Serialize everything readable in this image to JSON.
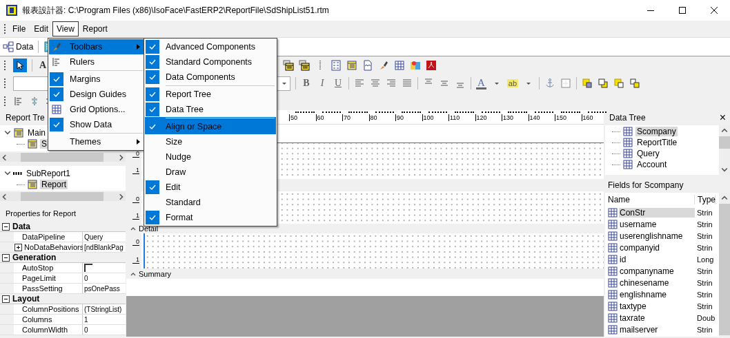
{
  "window": {
    "title": "報表設計器: C:\\Program Files (x86)\\IsoFace\\FastERP2\\ReportFile\\SdShipList51.rtm"
  },
  "menu_bar": [
    {
      "label": "File",
      "selected": false
    },
    {
      "label": "Edit",
      "selected": false
    },
    {
      "label": "View",
      "selected": true
    },
    {
      "label": "Report",
      "selected": false
    }
  ],
  "tab_bar": {
    "data_button": "Data"
  },
  "component_toolbar": {
    "label_tool": "A"
  },
  "format_toolbar": {
    "bold": "B",
    "italic": "I",
    "underline": "U",
    "font_color": "A",
    "highlight": "ab"
  },
  "view_menu": [
    {
      "label": "Toolbars",
      "kind": "tools",
      "checked": false,
      "selected": true,
      "submenu": true,
      "separator_before": false
    },
    {
      "label": "Rulers",
      "kind": "ruler",
      "checked": false,
      "selected": false,
      "submenu": false,
      "separator_before": false
    },
    {
      "label": "Margins",
      "checked": true,
      "selected": false,
      "submenu": false,
      "separator_before": true
    },
    {
      "label": "Design Guides",
      "checked": true,
      "selected": false,
      "submenu": false,
      "separator_before": false
    },
    {
      "label": "Grid Options...",
      "kind": "grid",
      "checked": false,
      "selected": false,
      "submenu": false,
      "separator_before": false
    },
    {
      "label": "Show Data",
      "checked": true,
      "selected": false,
      "submenu": false,
      "separator_before": false
    },
    {
      "label": "Themes",
      "checked": false,
      "selected": false,
      "submenu": true,
      "separator_before": true
    }
  ],
  "toolbars_submenu": [
    {
      "label": "Advanced Components",
      "checked": true,
      "selected": false,
      "separator_before": false
    },
    {
      "label": "Standard Components",
      "checked": true,
      "selected": false,
      "separator_before": false
    },
    {
      "label": "Data Components",
      "checked": true,
      "selected": false,
      "separator_before": false
    },
    {
      "label": "Report Tree",
      "checked": true,
      "selected": false,
      "separator_before": true
    },
    {
      "label": "Data Tree",
      "checked": true,
      "selected": false,
      "separator_before": false
    },
    {
      "label": "Align or Space",
      "checked": true,
      "selected": true,
      "separator_before": true
    },
    {
      "label": "Size",
      "checked": false,
      "selected": false,
      "separator_before": false
    },
    {
      "label": "Nudge",
      "checked": false,
      "selected": false,
      "separator_before": false
    },
    {
      "label": "Draw",
      "checked": false,
      "selected": false,
      "separator_before": false
    },
    {
      "label": "Edit",
      "checked": true,
      "selected": false,
      "separator_before": false
    },
    {
      "label": "Standard",
      "checked": false,
      "selected": false,
      "separator_before": false
    },
    {
      "label": "Format",
      "checked": true,
      "selected": false,
      "separator_before": false
    }
  ],
  "report_tree": {
    "title": "Report Tre",
    "items": [
      {
        "label": "Main",
        "selected": false,
        "children": [
          {
            "label": "S",
            "selected": true
          }
        ]
      }
    ]
  },
  "subreport_tree": {
    "items": [
      {
        "label": "SubReport1",
        "selected": false,
        "children": [
          {
            "label": "Report",
            "selected": true
          }
        ]
      }
    ]
  },
  "properties": {
    "title": "Properties for Report",
    "sections": [
      {
        "name": "Data",
        "expanded": true,
        "rows": [
          {
            "name": "DataPipeline",
            "kind": "text",
            "value": "Query"
          },
          {
            "name": "NoDataBehaviors",
            "kind": "collapsed",
            "value": "[ndBlankPag"
          }
        ]
      },
      {
        "name": "Generation",
        "expanded": true,
        "rows": [
          {
            "name": "AutoStop",
            "kind": "checkbox",
            "checked": false
          },
          {
            "name": "PageLimit",
            "kind": "text",
            "value": "0"
          },
          {
            "name": "PassSetting",
            "kind": "text",
            "value": "psOnePass"
          }
        ]
      },
      {
        "name": "Layout",
        "expanded": true,
        "rows": [
          {
            "name": "ColumnPositions",
            "kind": "text",
            "value": "(TStringList)"
          },
          {
            "name": "Columns",
            "kind": "text",
            "value": "1"
          },
          {
            "name": "ColumnWidth",
            "kind": "text",
            "value": "0"
          }
        ]
      }
    ]
  },
  "designer": {
    "ruler_labels": [
      "50",
      "60",
      "70",
      "80",
      "90",
      "100",
      "110",
      "120",
      "130",
      "140",
      "150",
      "160"
    ],
    "bands": [
      {
        "ruler": [
          "0",
          "1"
        ]
      },
      {
        "ruler": [
          "0",
          "1"
        ]
      },
      {
        "label": "Detail",
        "ruler": [
          "0",
          "1"
        ]
      },
      {
        "label": "Summary"
      }
    ]
  },
  "data_tree": {
    "title": "Data Tree",
    "close": "×",
    "items": [
      {
        "label": "Scompany",
        "selected": true
      },
      {
        "label": "ReportTitle",
        "selected": false
      },
      {
        "label": "Query",
        "selected": false
      },
      {
        "label": "Account",
        "selected": false
      }
    ]
  },
  "fields": {
    "title": "Fields for Scompany",
    "columns": [
      "Name",
      "Type"
    ],
    "rows": [
      {
        "name": "ConStr",
        "type": "Strin",
        "selected": true
      },
      {
        "name": "username",
        "type": "Strin",
        "selected": false
      },
      {
        "name": "userenglishname",
        "type": "Strin",
        "selected": false
      },
      {
        "name": "companyid",
        "type": "Strin",
        "selected": false
      },
      {
        "name": "id",
        "type": "Long",
        "selected": false
      },
      {
        "name": "companyname",
        "type": "Strin",
        "selected": false
      },
      {
        "name": "chinesename",
        "type": "Strin",
        "selected": false
      },
      {
        "name": "englishname",
        "type": "Strin",
        "selected": false
      },
      {
        "name": "taxtype",
        "type": "Strin",
        "selected": false
      },
      {
        "name": "taxrate",
        "type": "Doub",
        "selected": false
      },
      {
        "name": "mailserver",
        "type": "Strin",
        "selected": false
      }
    ]
  }
}
